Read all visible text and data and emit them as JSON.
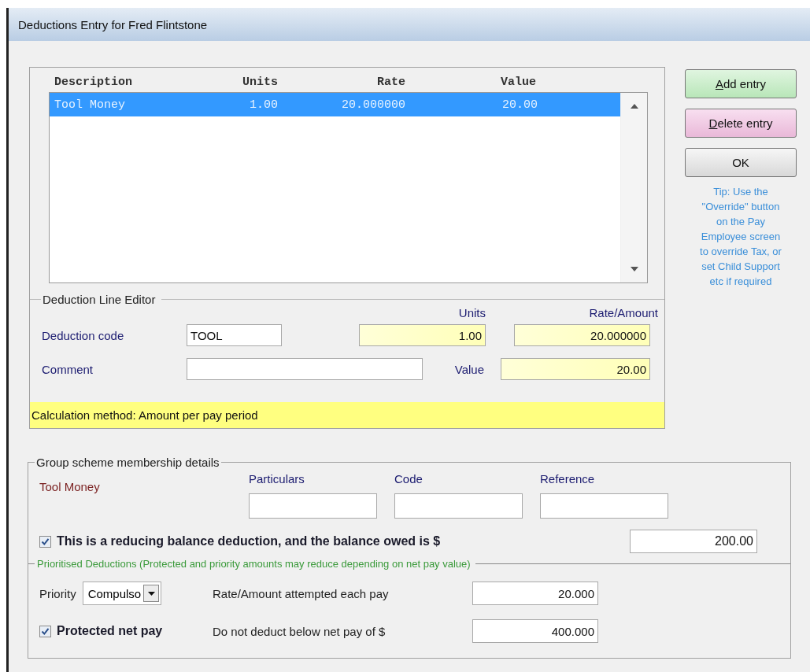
{
  "window": {
    "title": "Deductions Entry for Fred Flintstone"
  },
  "list": {
    "columns": [
      "Description",
      "Units",
      "Rate",
      "Value"
    ],
    "rows": [
      {
        "cells": [
          "Tool Money",
          "1.00",
          "20.000000",
          "20.00"
        ],
        "selected": true
      }
    ]
  },
  "buttons": [
    {
      "label": "Add entry",
      "kind": "add",
      "underline_first": true
    },
    {
      "label": "Delete entry",
      "kind": "delete",
      "underline_first": true
    },
    {
      "label": "OK",
      "kind": "ok"
    }
  ],
  "tip_lines": [
    "Tip: Use the",
    "\"Override\" button",
    "on the Pay",
    "Employee screen",
    "to override Tax, or",
    "set Child Support",
    "etc if required"
  ],
  "editor": {
    "title": "Deduction Line Editor",
    "code_label": "Deduction code",
    "code": "TOOL",
    "comment_label": "Comment",
    "units_label": "Units",
    "units": "1.00",
    "rate_label": "Rate/Amount",
    "rate": "20.000000",
    "value_label": "Value",
    "value": "20.00",
    "calculation": "Calculation method: Amount per pay period"
  },
  "group": {
    "title": "Group scheme membership details",
    "scheme": "Tool Money",
    "fields": [
      {
        "label": "Particulars"
      },
      {
        "label": "Code"
      },
      {
        "label": "Reference"
      }
    ],
    "reducing": {
      "label": "This is a reducing balance deduction, and the balance owed is $",
      "checked": true,
      "value": "200.00"
    },
    "prioritised": {
      "title": "Prioritised Deductions (Protected and priority amounts may reduce depending on net pay value)",
      "priority_label": "Priority",
      "priority": "Compulso",
      "attempt_label": "Rate/Amount attempted each pay",
      "attempt": "20.000",
      "protected": {
        "label": "Protected net pay",
        "checked": true
      },
      "floor_label": "Do not deduct below net pay of $",
      "floor": "400.000"
    }
  }
}
